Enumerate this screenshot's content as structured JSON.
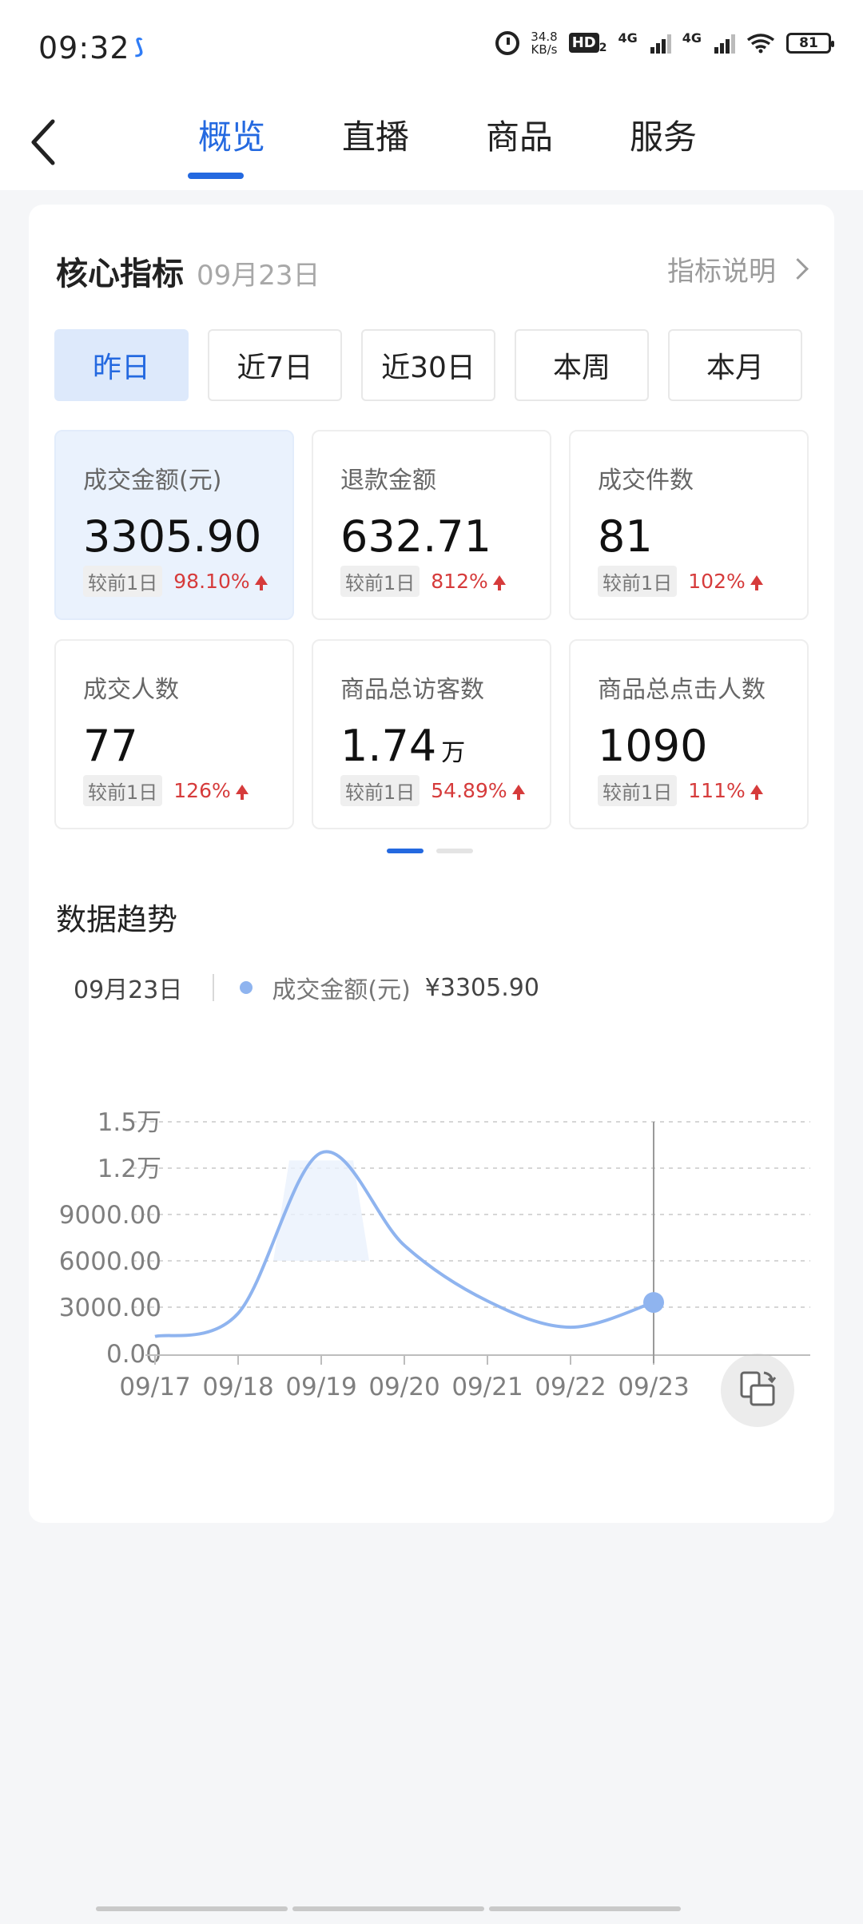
{
  "status_bar": {
    "time": "09:32",
    "net_speed_value": "34.8",
    "net_speed_unit": "KB/s",
    "hd_label": "HD",
    "hd_sub": "2",
    "net1": "4G",
    "net2": "4G",
    "battery": "81"
  },
  "nav": {
    "tabs": [
      "概览",
      "直播",
      "商品",
      "服务"
    ],
    "active_tab": 0
  },
  "core": {
    "title": "核心指标",
    "date": "09月23日",
    "explain_link": "指标说明"
  },
  "periods": {
    "items": [
      "昨日",
      "近7日",
      "近30日",
      "本周",
      "本月"
    ],
    "active": 0
  },
  "metrics": [
    {
      "label": "成交金额(元)",
      "value": "3305.90",
      "unit": "",
      "compare_label": "较前1日",
      "change": "98.10%",
      "trend": "up"
    },
    {
      "label": "退款金额",
      "value": "632.71",
      "unit": "",
      "compare_label": "较前1日",
      "change": "812%",
      "trend": "up"
    },
    {
      "label": "成交件数",
      "value": "81",
      "unit": "",
      "compare_label": "较前1日",
      "change": "102%",
      "trend": "up"
    },
    {
      "label": "成交人数",
      "value": "77",
      "unit": "",
      "compare_label": "较前1日",
      "change": "126%",
      "trend": "up"
    },
    {
      "label": "商品总访客数",
      "value": "1.74",
      "unit": "万",
      "compare_label": "较前1日",
      "change": "54.89%",
      "trend": "up"
    },
    {
      "label": "商品总点击人数",
      "value": "1090",
      "unit": "",
      "compare_label": "较前1日",
      "change": "111%",
      "trend": "up"
    }
  ],
  "pager": {
    "pages": 2,
    "current": 0
  },
  "trend": {
    "title": "数据趋势",
    "legend_date": "09月23日",
    "legend_series": "成交金额(元)",
    "legend_value": "¥3305.90"
  },
  "chart_data": {
    "type": "line",
    "x": [
      "09/17",
      "09/18",
      "09/19",
      "09/20",
      "09/21",
      "09/22",
      "09/23"
    ],
    "series": [
      {
        "name": "成交金额(元)",
        "values": [
          1100,
          2600,
          13000,
          7000,
          3400,
          1700,
          3305.9
        ]
      }
    ],
    "y_ticks": [
      "0.00",
      "3000.00",
      "6000.00",
      "9000.00",
      "1.2万",
      "1.5万"
    ],
    "ylim": [
      0,
      15000
    ],
    "grid": true,
    "highlight_index": 6,
    "color": "#8fb4ef"
  }
}
